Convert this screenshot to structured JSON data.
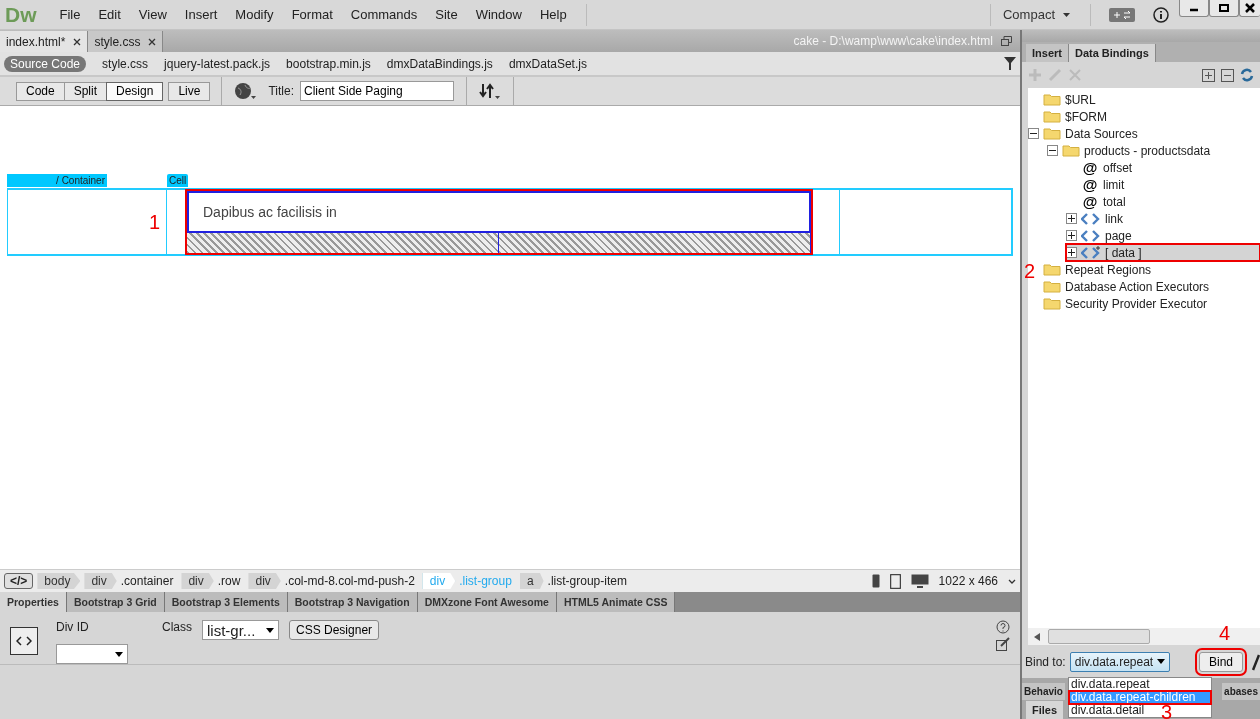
{
  "app_logo": "Dw",
  "menu": [
    "File",
    "Edit",
    "View",
    "Insert",
    "Modify",
    "Format",
    "Commands",
    "Site",
    "Window",
    "Help"
  ],
  "workspace": "Compact",
  "doc_tabs": [
    {
      "label": "index.html*",
      "selected": true
    },
    {
      "label": "style.css",
      "selected": false
    }
  ],
  "doc_path": "cake - D:\\wamp\\www\\cake\\index.html",
  "related_files": [
    {
      "label": "Source Code",
      "selected": true
    },
    {
      "label": "style.css",
      "selected": false
    },
    {
      "label": "jquery-latest.pack.js",
      "selected": false
    },
    {
      "label": "bootstrap.min.js",
      "selected": false
    },
    {
      "label": "dmxDataBindings.js",
      "selected": false
    },
    {
      "label": "dmxDataSet.js",
      "selected": false
    }
  ],
  "view_buttons": [
    {
      "label": "Code",
      "selected": false
    },
    {
      "label": "Split",
      "selected": false
    },
    {
      "label": "Design",
      "selected": true
    },
    {
      "label": "Live",
      "selected": false
    }
  ],
  "title_label": "Title:",
  "title_value": "Client Side Paging",
  "design": {
    "container_label": "/ Container",
    "cell_label": "Cell",
    "list_item": "Dapibus ac facilisis in",
    "annotation": "1",
    "outlined": true
  },
  "tag_selector_icon": "</>",
  "tag_selector": [
    {
      "tag": "body",
      "selected": false
    },
    {
      "tag": "div",
      "class": ".container",
      "selected": false
    },
    {
      "tag": "div",
      "class": ".row",
      "selected": false
    },
    {
      "tag": "div",
      "class": ".col-md-8.col-md-push-2",
      "selected": false
    },
    {
      "tag": "div",
      "class": ".list-group",
      "selected": true
    },
    {
      "tag": "a",
      "class": ".list-group-item",
      "selected": false
    }
  ],
  "window_size": "1022 x 466",
  "property_tabs": [
    {
      "label": "Properties",
      "selected": true
    },
    {
      "label": "Bootstrap 3 Grid",
      "selected": false
    },
    {
      "label": "Bootstrap 3 Elements",
      "selected": false
    },
    {
      "label": "Bootstrap 3 Navigation",
      "selected": false
    },
    {
      "label": "DMXzone Font Awesome",
      "selected": false
    },
    {
      "label": "HTML5 Animate CSS",
      "selected": false
    }
  ],
  "properties": {
    "div_id_label": "Div ID",
    "class_label": "Class",
    "class_value": "list-gr...",
    "css_designer": "CSS Designer"
  },
  "panel_tabs": [
    {
      "label": "Insert",
      "selected": false
    },
    {
      "label": "Data Bindings",
      "selected": true
    }
  ],
  "tree": [
    {
      "label": "$URL",
      "kind": "folder",
      "selected": false
    },
    {
      "label": "$FORM",
      "kind": "folder",
      "selected": false
    },
    {
      "label": "Data Sources",
      "kind": "folder",
      "expanded": true,
      "selected": false,
      "children": [
        {
          "label": "products - productsdata",
          "kind": "folder",
          "expanded": true,
          "selected": false,
          "children": [
            {
              "label": "offset",
              "kind": "property",
              "glyph": "@",
              "selected": false
            },
            {
              "label": "limit",
              "kind": "property",
              "glyph": "@",
              "selected": false
            },
            {
              "label": "total",
              "kind": "property",
              "glyph": "@",
              "selected": false
            },
            {
              "label": "link",
              "kind": "object",
              "expanded": false,
              "selected": false
            },
            {
              "label": "page",
              "kind": "object",
              "expanded": false,
              "selected": false
            },
            {
              "label": "[ data ]",
              "kind": "array",
              "expanded": false,
              "selected": true,
              "outlined": true
            }
          ]
        }
      ]
    },
    {
      "label": "Repeat Regions",
      "kind": "folder",
      "selected": false,
      "annotation": "2"
    },
    {
      "label": "Database Action Executors",
      "kind": "folder",
      "selected": false
    },
    {
      "label": "Security Provider Executor",
      "kind": "folder",
      "selected": false
    }
  ],
  "bind": {
    "label": "Bind to:",
    "value": "div.data.repeat",
    "button": "Bind",
    "button_outlined": true,
    "button_annotation": "4",
    "options": [
      {
        "label": "div.data.repeat",
        "highlighted": false
      },
      {
        "label": "div.data.repeat-children",
        "highlighted": true,
        "outlined": true,
        "annotation": "3"
      },
      {
        "label": "div.data.detail",
        "highlighted": false
      }
    ]
  },
  "panel_group_tabs": [
    {
      "label": "Behavio"
    },
    {
      "label": "abases"
    }
  ],
  "files_tab": "Files"
}
